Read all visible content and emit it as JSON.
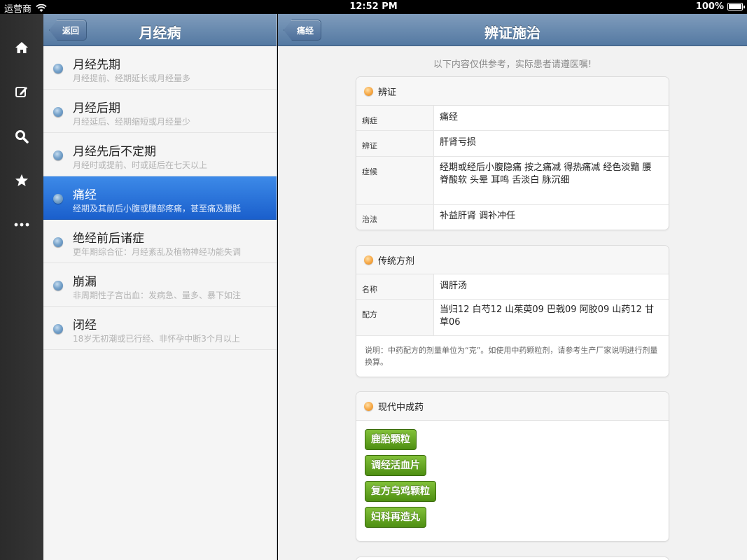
{
  "status_bar": {
    "carrier": "运营商",
    "time": "12:52 PM",
    "battery": "100%"
  },
  "dock": {
    "items": [
      "home-icon",
      "edit-icon",
      "search-icon",
      "star-icon",
      "more-icon"
    ]
  },
  "master": {
    "back_label": "返回",
    "title": "月经病",
    "items": [
      {
        "title": "月经先期",
        "subtitle": "月经提前、经期延长或月经量多"
      },
      {
        "title": "月经后期",
        "subtitle": "月经延后、经期缩短或月经量少"
      },
      {
        "title": "月经先后不定期",
        "subtitle": "月经时或提前、时或延后在七天以上"
      },
      {
        "title": "痛经",
        "subtitle": "经期及其前后小腹或腰部疼痛，甚至痛及腰骶"
      },
      {
        "title": "绝经前后诸症",
        "subtitle": "更年期综合征：月经紊乱及植物神经功能失调"
      },
      {
        "title": "崩漏",
        "subtitle": "非周期性子宫出血：发病急、量多、暴下如注"
      },
      {
        "title": "闭经",
        "subtitle": "18岁无初潮或已行经、非怀孕中断3个月以上"
      }
    ]
  },
  "detail": {
    "back_label": "痛经",
    "title": "辨证施治",
    "notice": "以下内容仅供参考，实际患者请遵医嘱!",
    "section1": {
      "heading": "辨证",
      "rows": [
        {
          "key": "病症",
          "value": "痛经"
        },
        {
          "key": "辨证",
          "value": "肝肾亏损"
        },
        {
          "key": "症候",
          "value": "经期或经后小腹隐痛 按之痛减 得热痛减 经色淡黯 腰脊酸软 头晕 耳鸣 舌淡白 脉沉细"
        },
        {
          "key": "治法",
          "value": "补益肝肾  调补冲任"
        }
      ]
    },
    "section2": {
      "heading": "传统方剂",
      "rows": [
        {
          "key": "名称",
          "value": "调肝汤"
        },
        {
          "key": "配方",
          "value": "当归12  白芍12  山茱萸09  巴戟09  阿胶09  山药12  甘草06"
        }
      ],
      "note": "说明：中药配方的剂量单位为“克”。如使用中药颗粒剂，请参考生产厂家说明进行剂量换算。"
    },
    "section3": {
      "heading": "现代中成药",
      "buttons": [
        "鹿胎颗粒",
        "调经活血片",
        "复方乌鸡颗粒",
        "妇科再造丸"
      ]
    }
  }
}
